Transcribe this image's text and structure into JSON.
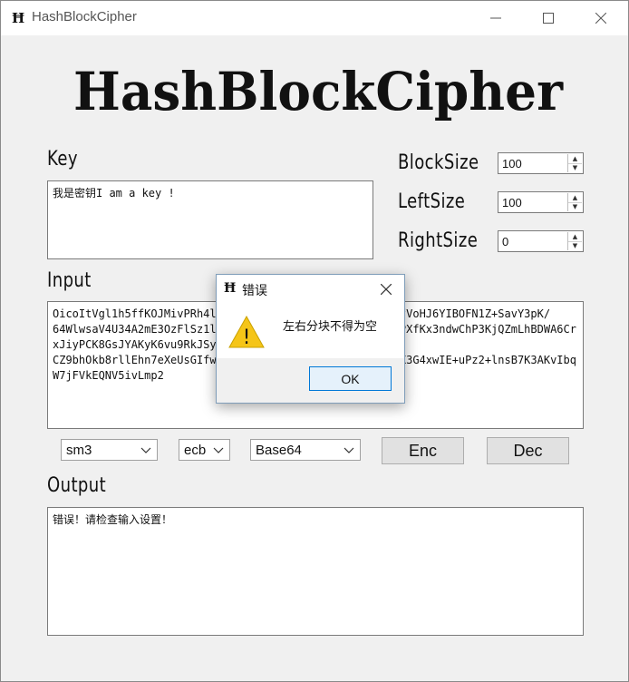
{
  "window": {
    "title": "HashBlockCipher",
    "app_icon_glyph": "Ħ"
  },
  "banner": {
    "text": "HashBlockCipher"
  },
  "key": {
    "label": "Key",
    "value": "我是密钥I am a key !"
  },
  "settings": {
    "block_size": {
      "label": "BlockSize",
      "value": "100"
    },
    "left_size": {
      "label": "LeftSize",
      "value": "100"
    },
    "right_size": {
      "label": "RightSize",
      "value": "0"
    }
  },
  "input": {
    "label": "Input",
    "value": "OicoItVgl1h5ffKOJMivPRh4lEXlR3mrW9OPbWnpmqC8FXBxeCbZffVoHJ6YIBOFN1Z+SavY3pK/\n64WlwsaV4U34A2mE3OzFlSz1l2oOhoKlE8CV6q5SYj8ZTuuqbBeqpPXfKx3ndwChP3KjQZmLhBDWA6CrxJiyPCK8GsJYAKyK6vu9RkJSyeLTbKC1IxkwHeD4IZvk/\nCZ9bhOkb8rllEhn7eXeUsGIfwpf0ex/LiqMCGC4aE7HlFuXLUtryXX3G4xwIE+uPz2+lnsB7K3AKvIbqW7jFVkEQNV5ivLmp2"
  },
  "controls": {
    "hash_select": "sm3",
    "mode_select": "ecb",
    "encoding_select": "Base64",
    "enc_button": "Enc",
    "dec_button": "Dec"
  },
  "output": {
    "label": "Output",
    "value": "错误！请检查输入设置！"
  },
  "dialog": {
    "title": "错误",
    "icon_glyph": "Ħ",
    "message": "左右分块不得为空",
    "ok_button": "OK",
    "warning_icon": "warning-icon",
    "warning_mark": "!"
  },
  "colors": {
    "warning_yellow": "#f5c518",
    "ok_border": "#0078d7"
  }
}
